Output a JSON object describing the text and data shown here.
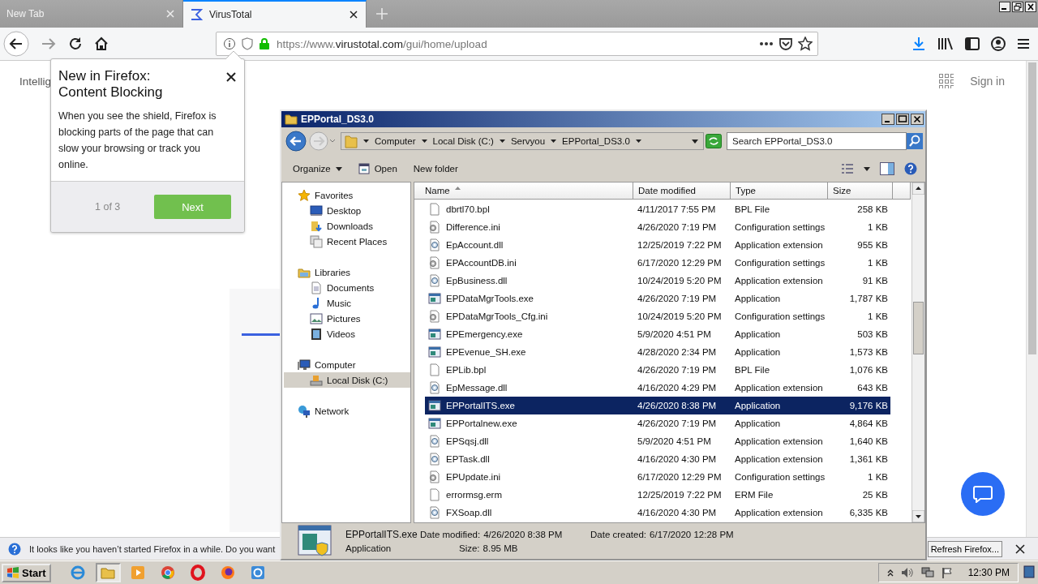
{
  "browser": {
    "tabs": [
      {
        "title": "New Tab",
        "kind": "blank",
        "selected": false
      },
      {
        "title": "VirusTotal",
        "kind": "site",
        "selected": true
      }
    ],
    "url": {
      "host_prefix": "https://www.",
      "host": "virustotal.com",
      "path": "/gui/home/upload"
    }
  },
  "page": {
    "heading": "Intellig",
    "sign_in": "Sign in"
  },
  "popup": {
    "title": "New in Firefox:\nContent Blocking",
    "body": "When you see the shield, Firefox is blocking parts of the page that can slow your browsing or track you online.",
    "counter": "1 of 3",
    "button": "Next"
  },
  "explorer": {
    "title": "EPPortal_DS3.0",
    "breadcrumb": [
      "Computer",
      "Local Disk (C:)",
      "Servyou",
      "EPPortal_DS3.0"
    ],
    "search": {
      "placeholder": "Search EPPortal_DS3.0"
    },
    "toolbar": [
      {
        "label": "Organize",
        "kind": "menu"
      },
      {
        "label": "Open",
        "kind": "open"
      },
      {
        "label": "New folder",
        "kind": "plain"
      }
    ],
    "nav": [
      {
        "label": "Favorites",
        "kind": "star",
        "selected": false,
        "children": [
          {
            "label": "Desktop",
            "kind": "desktop",
            "selected": false
          },
          {
            "label": "Downloads",
            "kind": "downloads",
            "selected": false
          },
          {
            "label": "Recent Places",
            "kind": "recent",
            "selected": false
          }
        ]
      },
      {
        "label": "Libraries",
        "kind": "library",
        "selected": false,
        "children": [
          {
            "label": "Documents",
            "kind": "document",
            "selected": false
          },
          {
            "label": "Music",
            "kind": "music",
            "selected": false
          },
          {
            "label": "Pictures",
            "kind": "pictures",
            "selected": false
          },
          {
            "label": "Videos",
            "kind": "videos",
            "selected": false
          }
        ]
      },
      {
        "label": "Computer",
        "kind": "computer",
        "selected": false,
        "children": [
          {
            "label": "Local Disk (C:)",
            "kind": "disk",
            "selected": true
          }
        ]
      },
      {
        "label": "Network",
        "kind": "network",
        "selected": false
      }
    ],
    "columns": [
      "Name",
      "Date modified",
      "Type",
      "Size"
    ],
    "rows": [
      {
        "name": "dbrtl70.bpl",
        "date": "4/11/2017 7:55 PM",
        "type": "BPL File",
        "size": "258 KB",
        "kind": "file",
        "selected": false
      },
      {
        "name": "Difference.ini",
        "date": "4/26/2020 7:19 PM",
        "type": "Configuration settings",
        "size": "1 KB",
        "kind": "config",
        "selected": false
      },
      {
        "name": "EpAccount.dll",
        "date": "12/25/2019 7:22 PM",
        "type": "Application extension",
        "size": "955 KB",
        "kind": "dll",
        "selected": false
      },
      {
        "name": "EPAccountDB.ini",
        "date": "6/17/2020 12:29 PM",
        "type": "Configuration settings",
        "size": "1 KB",
        "kind": "config",
        "selected": false
      },
      {
        "name": "EpBusiness.dll",
        "date": "10/24/2019 5:20 PM",
        "type": "Application extension",
        "size": "91 KB",
        "kind": "dll",
        "selected": false
      },
      {
        "name": "EPDataMgrTools.exe",
        "date": "4/26/2020 7:19 PM",
        "type": "Application",
        "size": "1,787 KB",
        "kind": "exe",
        "selected": false
      },
      {
        "name": "EPDataMgrTools_Cfg.ini",
        "date": "10/24/2019 5:20 PM",
        "type": "Configuration settings",
        "size": "1 KB",
        "kind": "config",
        "selected": false
      },
      {
        "name": "EPEmergency.exe",
        "date": "5/9/2020 4:51 PM",
        "type": "Application",
        "size": "503 KB",
        "kind": "exe",
        "selected": false
      },
      {
        "name": "EPEvenue_SH.exe",
        "date": "4/28/2020 2:34 PM",
        "type": "Application",
        "size": "1,573 KB",
        "kind": "exe",
        "selected": false
      },
      {
        "name": "EPLib.bpl",
        "date": "4/26/2020 7:19 PM",
        "type": "BPL File",
        "size": "1,076 KB",
        "kind": "file",
        "selected": false
      },
      {
        "name": "EpMessage.dll",
        "date": "4/16/2020 4:29 PM",
        "type": "Application extension",
        "size": "643 KB",
        "kind": "dll",
        "selected": false
      },
      {
        "name": "EPPortalITS.exe",
        "date": "4/26/2020 8:38 PM",
        "type": "Application",
        "size": "9,176 KB",
        "kind": "exe",
        "selected": true
      },
      {
        "name": "EPPortalnew.exe",
        "date": "4/26/2020 7:19 PM",
        "type": "Application",
        "size": "4,864 KB",
        "kind": "exe",
        "selected": false
      },
      {
        "name": "EPSqsj.dll",
        "date": "5/9/2020 4:51 PM",
        "type": "Application extension",
        "size": "1,640 KB",
        "kind": "dll",
        "selected": false
      },
      {
        "name": "EPTask.dll",
        "date": "4/16/2020 4:30 PM",
        "type": "Application extension",
        "size": "1,361 KB",
        "kind": "dll",
        "selected": false
      },
      {
        "name": "EPUpdate.ini",
        "date": "6/17/2020 12:29 PM",
        "type": "Configuration settings",
        "size": "1 KB",
        "kind": "config",
        "selected": false
      },
      {
        "name": "errormsg.erm",
        "date": "12/25/2019 7:22 PM",
        "type": "ERM File",
        "size": "25 KB",
        "kind": "file",
        "selected": false
      },
      {
        "name": "FXSoap.dll",
        "date": "4/16/2020 4:30 PM",
        "type": "Application extension",
        "size": "6,335 KB",
        "kind": "dll",
        "selected": false
      }
    ],
    "details": {
      "name": "EPPortalITS.exe",
      "type": "Application",
      "fields": [
        {
          "label": "Date modified:",
          "value": "4/26/2020 8:38 PM"
        },
        {
          "label": "Size:",
          "value": "8.95 MB"
        },
        {
          "label": "Date created:",
          "value": "6/17/2020 12:28 PM"
        }
      ]
    }
  },
  "notification": {
    "text": "It looks like you haven’t started Firefox in a while. Do you want",
    "button": "Refresh Firefox..."
  },
  "taskbar": {
    "start": "Start",
    "apps": [
      {
        "kind": "ie",
        "selected": false
      },
      {
        "kind": "folder",
        "selected": true
      },
      {
        "kind": "media",
        "selected": false
      },
      {
        "kind": "chrome",
        "selected": false
      },
      {
        "kind": "opera",
        "selected": false
      },
      {
        "kind": "firefox",
        "selected": false
      },
      {
        "kind": "app",
        "selected": false
      }
    ],
    "clock": "12:30 PM"
  }
}
